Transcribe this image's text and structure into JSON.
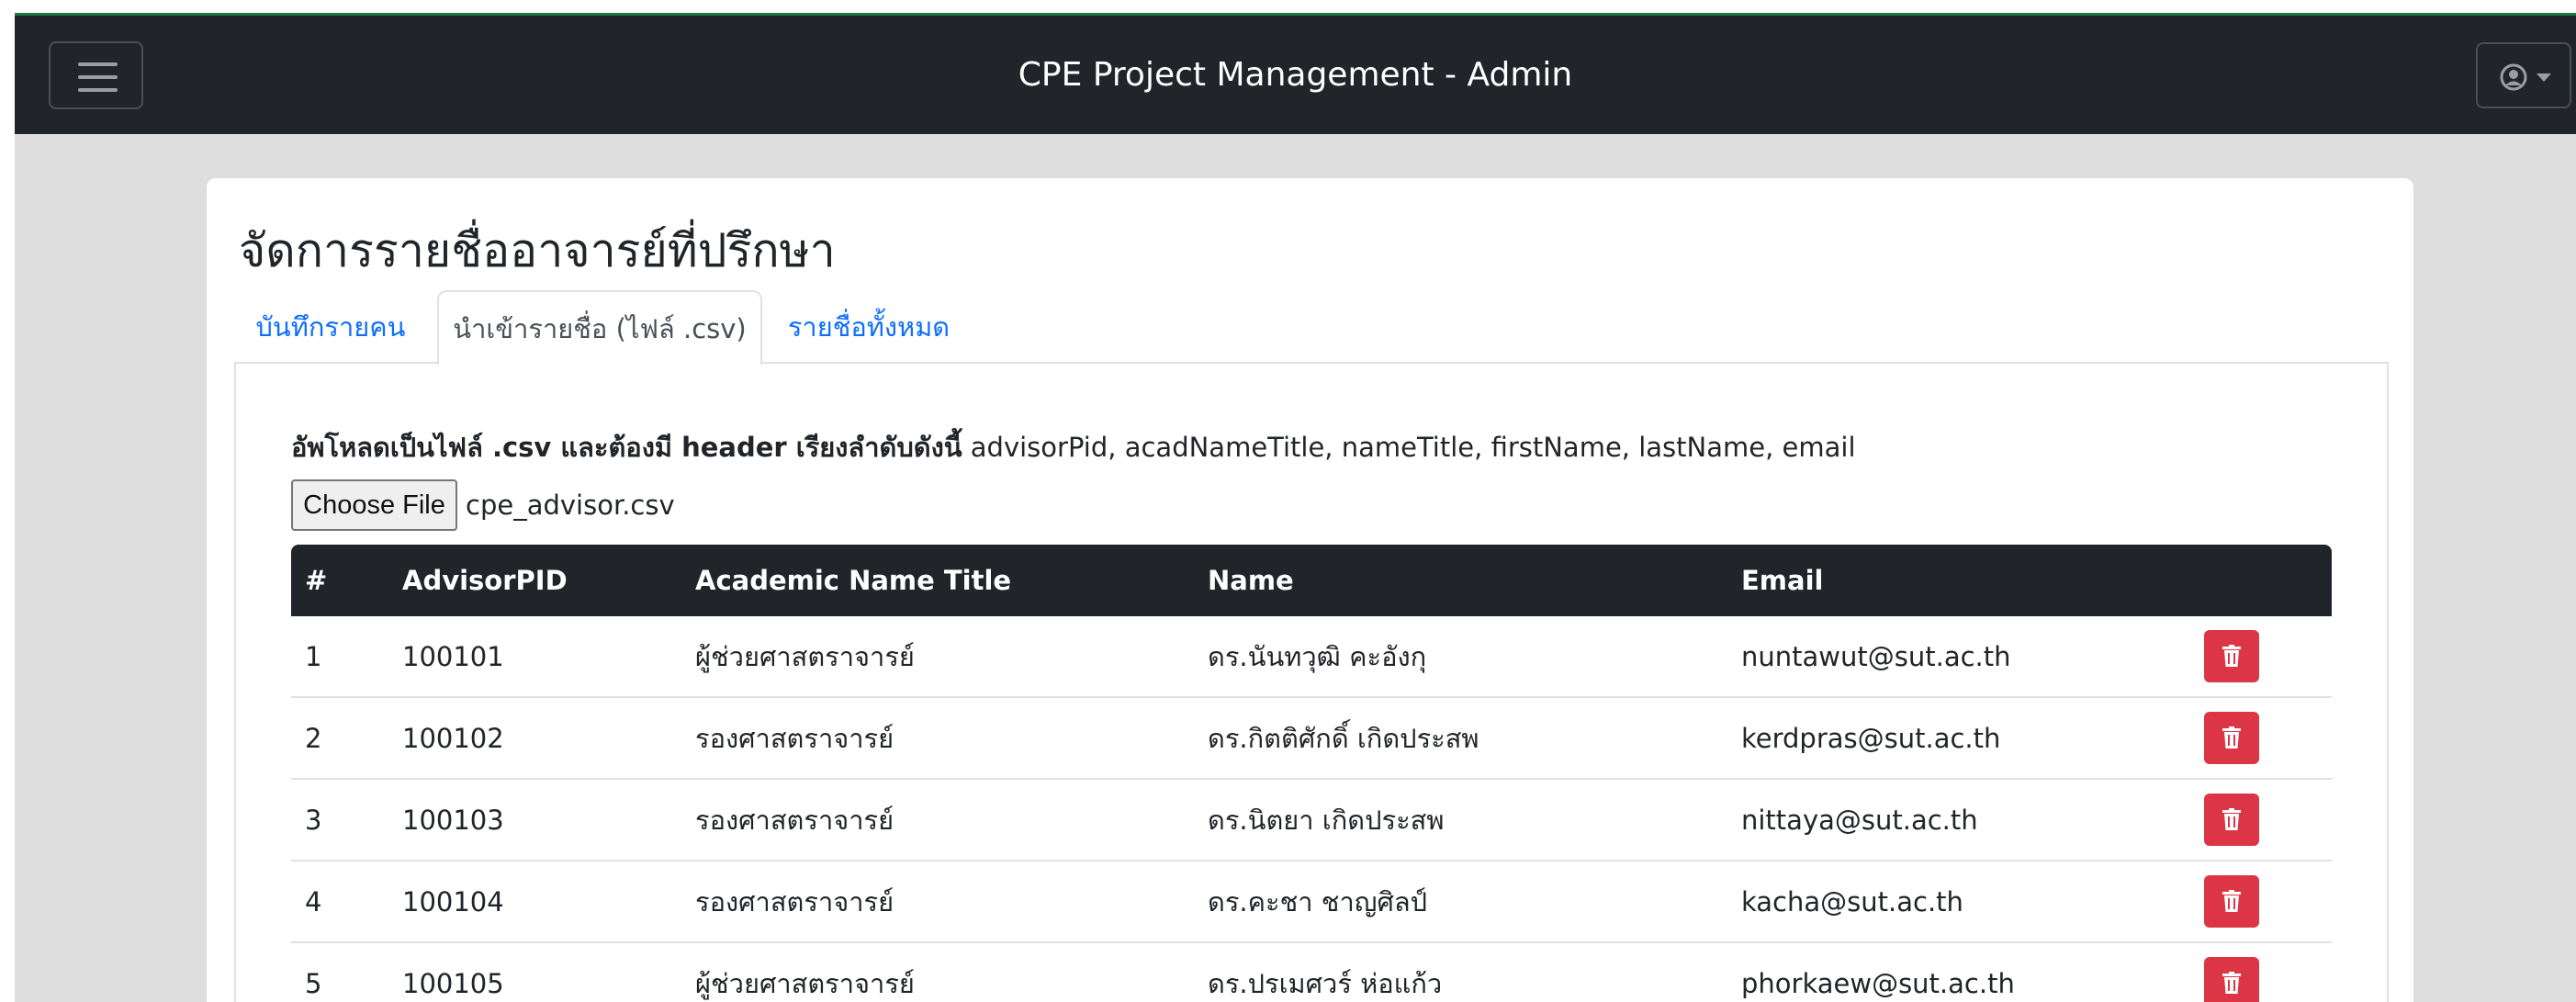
{
  "navbar": {
    "title": "CPE Project Management - Admin",
    "menu_icon": "hamburger-menu-icon",
    "user_icon": "user-circle-icon"
  },
  "card": {
    "title": "จัดการรายชื่ออาจารย์ที่ปรึกษา"
  },
  "tabs": [
    {
      "label": "บันทึกรายคน",
      "active": false
    },
    {
      "label": "นำเข้ารายชื่อ (ไฟล์ .csv)",
      "active": true
    },
    {
      "label": "รายชื่อทั้งหมด",
      "active": false
    }
  ],
  "upload": {
    "instruction_bold": "อัพโหลดเป็นไฟล์ .csv และต้องมี header เรียงลำดับดังนี้",
    "instruction_fields": " advisorPid, acadNameTitle, nameTitle, firstName, lastName, email",
    "button_label": "Choose File",
    "file_name": "cpe_advisor.csv"
  },
  "table": {
    "headers": [
      "#",
      "AdvisorPID",
      "Academic Name Title",
      "Name",
      "Email"
    ],
    "rows": [
      {
        "no": "1",
        "pid": "100101",
        "acad_title": "ผู้ช่วยศาสตราจารย์",
        "name": "ดร.นันทวุฒิ คะอังกุ",
        "email": "nuntawut@sut.ac.th"
      },
      {
        "no": "2",
        "pid": "100102",
        "acad_title": "รองศาสตราจารย์",
        "name": "ดร.กิตติศักดิ์ เกิดประสพ",
        "email": "kerdpras@sut.ac.th"
      },
      {
        "no": "3",
        "pid": "100103",
        "acad_title": "รองศาสตราจารย์",
        "name": "ดร.นิตยา เกิดประสพ",
        "email": "nittaya@sut.ac.th"
      },
      {
        "no": "4",
        "pid": "100104",
        "acad_title": "รองศาสตราจารย์",
        "name": "ดร.คะชา ชาญศิลป์",
        "email": "kacha@sut.ac.th"
      },
      {
        "no": "5",
        "pid": "100105",
        "acad_title": "ผู้ช่วยศาสตราจารย์",
        "name": "ดร.ปรเมศวร์ ห่อแก้ว",
        "email": "phorkaew@sut.ac.th"
      }
    ],
    "delete_icon": "trash-icon"
  },
  "colors": {
    "navbar_bg": "#212529",
    "page_bg": "#dedede",
    "link": "#0d6efd",
    "danger": "#dc3545"
  }
}
